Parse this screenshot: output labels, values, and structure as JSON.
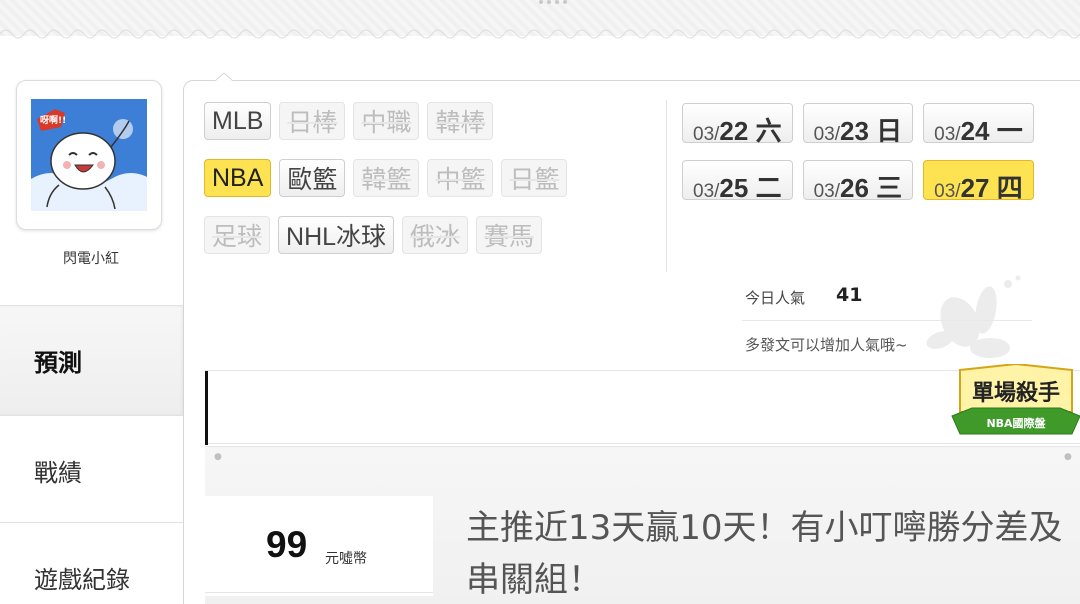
{
  "user": {
    "name": "閃電小紅",
    "avatar_caption": "呀啊!!"
  },
  "sidebar": {
    "items": [
      {
        "label": "預測",
        "active": true
      },
      {
        "label": "戰績",
        "active": false
      },
      {
        "label": "遊戲紀錄",
        "active": false
      }
    ]
  },
  "leagues": {
    "row1": [
      {
        "label": "MLB",
        "state": "normal"
      },
      {
        "label": "日棒",
        "state": "disabled"
      },
      {
        "label": "中職",
        "state": "disabled"
      },
      {
        "label": "韓棒",
        "state": "disabled"
      }
    ],
    "row2": [
      {
        "label": "NBA",
        "state": "active"
      },
      {
        "label": "歐籃",
        "state": "normal"
      },
      {
        "label": "韓籃",
        "state": "disabled"
      },
      {
        "label": "中籃",
        "state": "disabled"
      },
      {
        "label": "日籃",
        "state": "disabled"
      }
    ],
    "row3": [
      {
        "label": "足球",
        "state": "disabled"
      },
      {
        "label": "NHL冰球",
        "state": "normal"
      },
      {
        "label": "俄冰",
        "state": "disabled"
      },
      {
        "label": "賽馬",
        "state": "disabled"
      }
    ]
  },
  "dates": {
    "row1": [
      {
        "month": "03/",
        "day": "22 六",
        "active": false
      },
      {
        "month": "03/",
        "day": "23 日",
        "active": false
      },
      {
        "month": "03/",
        "day": "24 一",
        "active": false
      }
    ],
    "row2": [
      {
        "month": "03/",
        "day": "25 二",
        "active": false
      },
      {
        "month": "03/",
        "day": "26 三",
        "active": false
      },
      {
        "month": "03/",
        "day": "27 四",
        "active": true
      }
    ]
  },
  "popularity": {
    "label": "今日人氣",
    "value": "41",
    "hint": "多發文可以增加人氣哦~"
  },
  "badge": {
    "title": "單場殺手",
    "subtitle": "NBA國際盤"
  },
  "post": {
    "price": "99",
    "price_unit": "元噓幣",
    "headline": "主推近13天贏10天！有小叮嚀勝分差及串關組！"
  },
  "colors": {
    "active_yellow": "#fde352",
    "badge_green": "#3f9a2a"
  }
}
